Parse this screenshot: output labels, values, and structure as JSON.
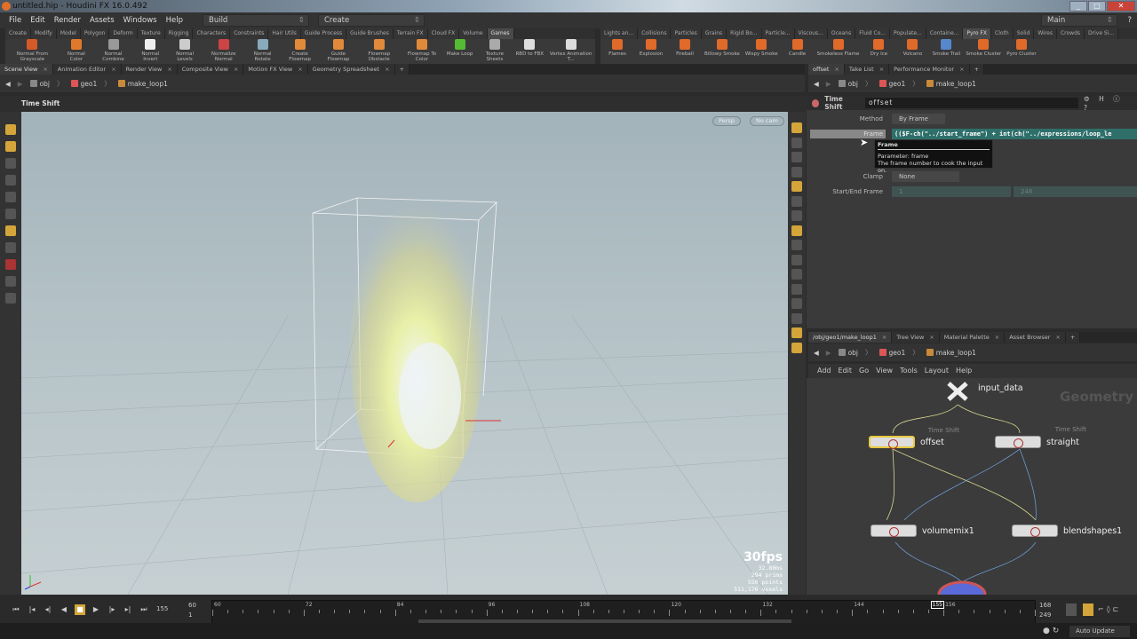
{
  "window": {
    "title": "untitled.hip - Houdini FX 16.0.492"
  },
  "menu": [
    "File",
    "Edit",
    "Render",
    "Assets",
    "Windows",
    "Help"
  ],
  "desktop": "Build",
  "context": "Create",
  "workspace": "Main",
  "shelf_tabs_left": [
    "Create",
    "Modify",
    "Model",
    "Polygon",
    "Deform",
    "Texture",
    "Rigging",
    "Characters",
    "Constraints",
    "Hair Utils",
    "Guide Process",
    "Guide Brushes",
    "Terrain FX",
    "Cloud FX",
    "Volume",
    "Games"
  ],
  "shelf_tools_left": [
    "Normal From Grayscale",
    "Normal Color",
    "Normal Combine",
    "Normal Invert",
    "Normal Levels",
    "Normalize Normal",
    "Normal Rotate",
    "Create Flowmap",
    "Guide Flowmap",
    "Flowmap Obstacle",
    "Flowmap To Color",
    "Make Loop",
    "Texture Sheets",
    "RBD to FBX",
    "Vertex Animation T..."
  ],
  "shelf_tabs_right": [
    "Lights an...",
    "Collisions",
    "Particles",
    "Grains",
    "Rigid Bo...",
    "Particle...",
    "Viscous...",
    "Oceans",
    "Fluid Co...",
    "Populate...",
    "Containe...",
    "Pyro FX",
    "Cloth",
    "Solid",
    "Wires",
    "Crowds",
    "Drive Si..."
  ],
  "shelf_tools_right": [
    "Flames",
    "Explosion",
    "Fireball",
    "Billowy Smoke",
    "Wispy Smoke",
    "Candle",
    "Smokeless Flame",
    "Dry Ice",
    "Volcano",
    "Smoke Trail",
    "Smoke Cluster",
    "Pyro Cluster"
  ],
  "left_tabs": [
    "Scene View",
    "Animation Editor",
    "Render View",
    "Composite View",
    "Motion FX View",
    "Geometry Spreadsheet"
  ],
  "right_tabs": [
    "offset",
    "Take List",
    "Performance Monitor"
  ],
  "path": [
    "obj",
    "geo1",
    "make_loop1"
  ],
  "viewer": {
    "operator": "Time Shift",
    "persp": "Persp",
    "cam": "No cam",
    "fps": "30fps",
    "time": "32.80ms",
    "prims": "294  prims",
    "points": "550 points",
    "voxels": "511,176 voxels"
  },
  "params": {
    "type": "Time Shift",
    "name": "offset",
    "method_label": "Method",
    "method": "By Frame",
    "frame_label": "Frame",
    "frame_expr": "(($F-ch(\"../start_frame\") + int(ch(\"../expressions/loop_le",
    "clamp_label": "Clamp",
    "clamp": "None",
    "startend_label": "Start/End Frame",
    "start": "1",
    "end": "248"
  },
  "tooltip": {
    "title": "Frame",
    "line1": "Parameter: frame",
    "line2": "The frame number to cook the input on."
  },
  "net_tabs": [
    "/obj/geo1/make_loop1",
    "Tree View",
    "Material Palette",
    "Asset Browser"
  ],
  "net_menu": [
    "Add",
    "Edit",
    "Go",
    "View",
    "Tools",
    "Layout",
    "Help"
  ],
  "network": {
    "context_label": "Geometry",
    "nodes": [
      {
        "name": "input_data",
        "type": "Null"
      },
      {
        "name": "offset",
        "type": "Time Shift"
      },
      {
        "name": "straight",
        "type": "Time Shift"
      },
      {
        "name": "volumemix1",
        "type": ""
      },
      {
        "name": "blendshapes1",
        "type": ""
      }
    ]
  },
  "timeline": {
    "current": "155",
    "start": "60",
    "start_global": "1",
    "end": "168",
    "end_global": "249",
    "ticks": [
      "60",
      "72",
      "84",
      "96",
      "108",
      "120",
      "132",
      "144",
      "156"
    ],
    "marker": "155"
  },
  "status": {
    "update": "Auto Update"
  },
  "colors": {
    "accent": "#d4a53a",
    "expr_field": "#2f6f6a"
  }
}
